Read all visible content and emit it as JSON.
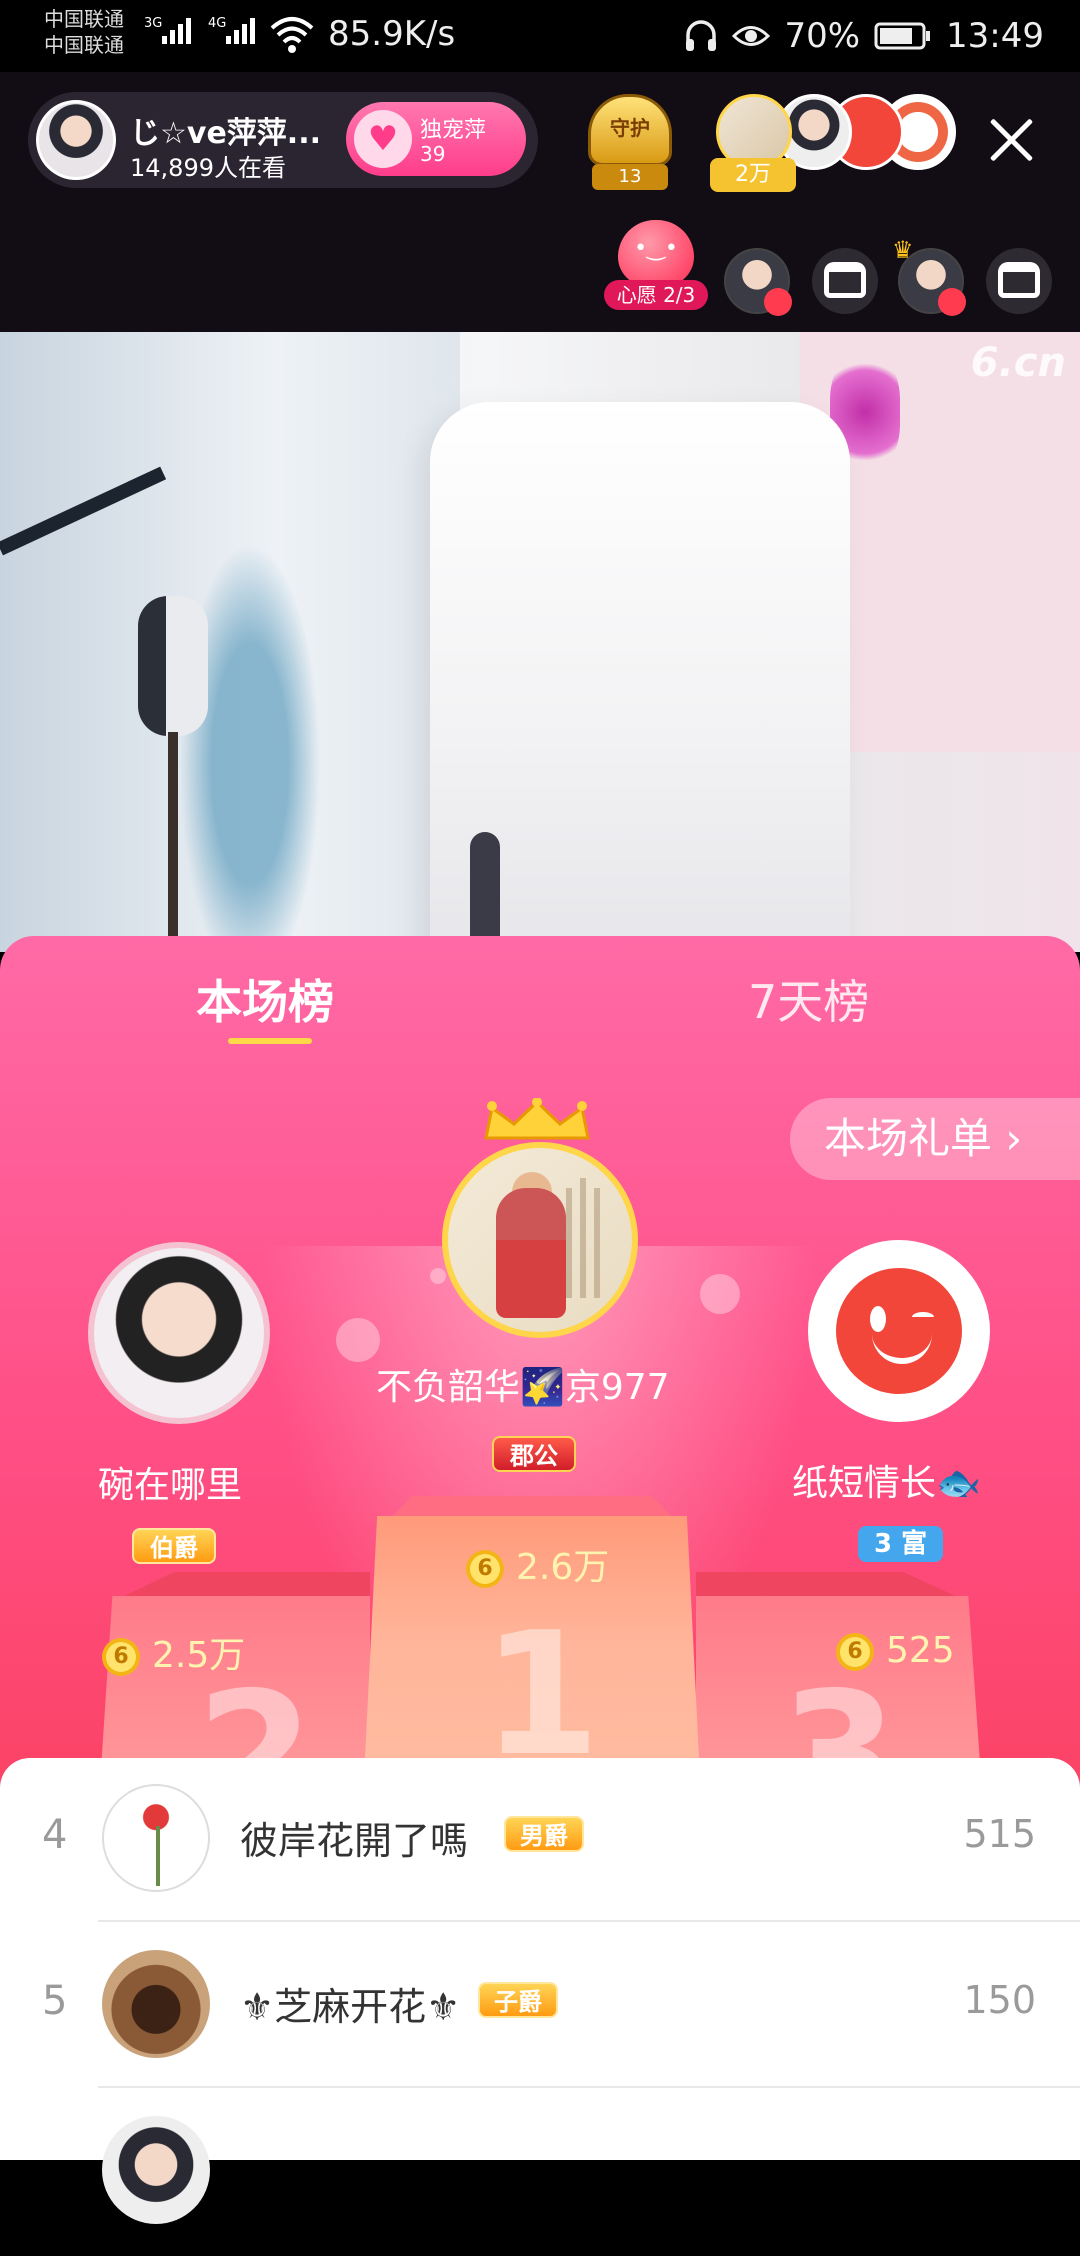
{
  "status_bar": {
    "carrier_1": "中国联通",
    "carrier_2": "中国联通",
    "net_1": "3G",
    "net_2": "4G",
    "speed": "85.9K/s",
    "battery": "70%",
    "time": "13:49"
  },
  "live": {
    "host_name": "じ☆ve萍萍...",
    "viewers": "14,899人在看",
    "follow_label": "独宠萍",
    "follow_count": "39",
    "guard_label": "守护",
    "guard_count": "13",
    "top_viewer_badge": "2万",
    "wish_label": "心愿 2/3",
    "watermark": "6.cn"
  },
  "ranking": {
    "tabs": [
      "本场榜",
      "7天榜"
    ],
    "gift_list_button": "本场礼单 ›",
    "podium": [
      {
        "rank": "1",
        "name": "不负韶华🌠京977",
        "badge": "郡公",
        "score": "2.6万"
      },
      {
        "rank": "2",
        "name": "碗在哪里",
        "badge": "伯爵",
        "score": "2.5万"
      },
      {
        "rank": "3",
        "name": "纸短情长🐟",
        "badge": "3 富",
        "score": "525"
      }
    ],
    "coin_glyph": "6",
    "list": [
      {
        "rank": "4",
        "name": "彼岸花開了嗎",
        "badge": "男爵",
        "score": "515"
      },
      {
        "rank": "5",
        "name": "⚜芝麻开花⚜",
        "badge": "子爵",
        "score": "150"
      }
    ]
  },
  "colors": {
    "sheet_top": "#ff6aa6",
    "sheet_bottom": "#fb3f5a",
    "accent_gold": "#ffd84a",
    "follow_pink": "#ff3d8b"
  }
}
